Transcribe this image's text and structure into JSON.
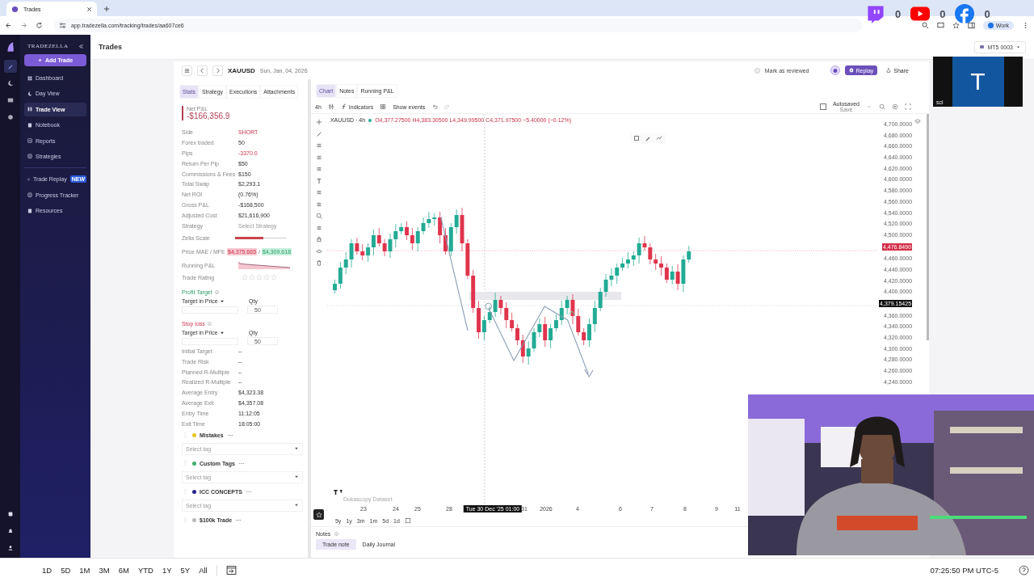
{
  "browser": {
    "tab": {
      "title": "Trades"
    },
    "url": "app.tradezella.com/tracking/trades/aa607ce6",
    "profile": "Work"
  },
  "overlay": {
    "social": [
      {
        "kind": "twitch",
        "count": "0"
      },
      {
        "kind": "youtube",
        "count": "0"
      },
      {
        "kind": "facebook",
        "count": "0"
      }
    ],
    "tile_letter": "T",
    "tile_caption": "sci"
  },
  "sidebar": {
    "brand": "TRADEZELLA",
    "add_button": "Add Trade",
    "items": [
      {
        "label": "Dashboard",
        "selected": false
      },
      {
        "label": "Day View",
        "selected": false
      },
      {
        "label": "Trade View",
        "selected": true
      },
      {
        "label": "Notebook",
        "selected": false
      },
      {
        "label": "Reports",
        "selected": false
      },
      {
        "label": "Strategies",
        "selected": false
      },
      {
        "label": "Trade Replay",
        "selected": false,
        "badge": "NEW"
      },
      {
        "label": "Progress Tracker",
        "selected": false
      },
      {
        "label": "Resources",
        "selected": false
      }
    ]
  },
  "header": {
    "title": "Trades",
    "account": "MT5 0003"
  },
  "trade": {
    "symbol": "XAUUSD",
    "date": "Sun, Jan, 04, 2026",
    "review": {
      "label": "Mark as reviewed",
      "checked": false
    },
    "replay": "Replay",
    "share": "Share"
  },
  "stats_tabs": [
    {
      "label": "Stats",
      "selected": true
    },
    {
      "label": "Strategy",
      "selected": false
    },
    {
      "label": "Executions",
      "selected": false
    },
    {
      "label": "Attachments",
      "selected": false
    }
  ],
  "chart_tabs": [
    {
      "label": "Chart",
      "selected": true
    },
    {
      "label": "Notes",
      "selected": false
    },
    {
      "label": "Running P&L",
      "selected": false
    }
  ],
  "stats": {
    "net_label": "Net P&L",
    "net_value": "-$166,356.9",
    "rows": [
      {
        "label": "Side",
        "value": "SHORT",
        "kind": "negative"
      },
      {
        "label": "Forex traded",
        "value": "50",
        "kind": "normal"
      },
      {
        "label": "Pips",
        "value": "-3370.0",
        "kind": "negative"
      },
      {
        "label": "Return Per Pip",
        "value": "$50",
        "kind": "normal"
      },
      {
        "label": "Commissions & Fees",
        "value": "$150",
        "kind": "normal"
      },
      {
        "label": "Total Swap",
        "value": "$2,293.1",
        "kind": "normal"
      },
      {
        "label": "Net ROI",
        "value": "(0.76%)",
        "kind": "normal"
      },
      {
        "label": "Gross P&L",
        "value": "-$168,500",
        "kind": "normal"
      },
      {
        "label": "Adjusted Cost",
        "value": "$21,616,900",
        "kind": "normal"
      },
      {
        "label": "Strategy",
        "value": "Select Strategy",
        "kind": "muted"
      }
    ],
    "zella": {
      "label": "Zella Scale",
      "level": 0.55
    },
    "mae_mfe": {
      "label": "Price MAE / MFE",
      "mae": "$4,375.665",
      "separator": "/",
      "mfe": "$4,309.618"
    },
    "running": {
      "label": "Running P&L"
    },
    "rating": {
      "label": "Trade Rating",
      "stars": 0
    },
    "targets": [
      {
        "title": "Profit Target",
        "kind": "positive",
        "mode": "Target in Price",
        "qty_label": "Qty",
        "qty": "50"
      },
      {
        "title": "Stop loss",
        "kind": "negative",
        "mode": "Target in Price",
        "qty_label": "Qty",
        "qty": "50"
      }
    ],
    "rows2": [
      {
        "label": "Initial Target",
        "value": "--"
      },
      {
        "label": "Trade Risk",
        "value": "--"
      },
      {
        "label": "Planned R-Multiple",
        "value": "--"
      },
      {
        "label": "Realized R-Multiple",
        "value": "--"
      },
      {
        "label": "Average Entry",
        "value": "$4,323.38"
      },
      {
        "label": "Average Exit",
        "value": "$4,357.08"
      },
      {
        "label": "Entry Time",
        "value": "11:12:05"
      },
      {
        "label": "Exit Time",
        "value": "18:05:00"
      }
    ],
    "tag_groups": [
      {
        "name": "Mistakes",
        "color": "#e8c21e",
        "placeholder": "Select tag"
      },
      {
        "name": "Custom Tags",
        "color": "#3cae6a",
        "placeholder": "Select tag"
      },
      {
        "name": "ICC CONCEPTS",
        "color": "#25258f",
        "placeholder": "Select tag"
      },
      {
        "name": "$100k Trade",
        "color": "#b8b8b8"
      }
    ]
  },
  "chart": {
    "toolbar": {
      "interval": "4h",
      "indicators": "Indicators",
      "events": "Show events",
      "autosaved": "Autosaved",
      "save": "Save",
      "checked": false
    },
    "legend": {
      "symbol": "XAUUSD · 4h",
      "ohlc": "O4,377.27500 H4,383.30500 L4,349.99500 C4,371.97500 −5.40000 (−0.12%)"
    },
    "price_labels": [
      {
        "text": "4,700.0000",
        "kind": "tick"
      },
      {
        "text": "4,680.0000",
        "kind": "tick"
      },
      {
        "text": "4,660.0000",
        "kind": "tick"
      },
      {
        "text": "4,640.0000",
        "kind": "tick"
      },
      {
        "text": "4,620.0000",
        "kind": "tick"
      },
      {
        "text": "4,600.0000",
        "kind": "tick"
      },
      {
        "text": "4,580.0000",
        "kind": "tick"
      },
      {
        "text": "4,560.0000",
        "kind": "tick"
      },
      {
        "text": "4,540.0000",
        "kind": "tick"
      },
      {
        "text": "4,520.0000",
        "kind": "tick"
      },
      {
        "text": "4,500.0000",
        "kind": "tick"
      },
      {
        "text": "4,476.8490",
        "kind": "current"
      },
      {
        "text": "4,460.0000",
        "kind": "tick"
      },
      {
        "text": "4,440.0000",
        "kind": "tick"
      },
      {
        "text": "4,420.0000",
        "kind": "tick"
      },
      {
        "text": "4,400.0000",
        "kind": "tick"
      },
      {
        "text": "4,379.15425",
        "kind": "cursor"
      },
      {
        "text": "4,360.0000",
        "kind": "tick"
      },
      {
        "text": "4,340.0000",
        "kind": "tick"
      },
      {
        "text": "4,320.0000",
        "kind": "tick"
      },
      {
        "text": "4,300.0000",
        "kind": "tick"
      },
      {
        "text": "4,280.0000",
        "kind": "tick"
      },
      {
        "text": "4,260.0000",
        "kind": "tick"
      },
      {
        "text": "4,240.0000",
        "kind": "tick"
      }
    ],
    "time_labels": [
      {
        "text": "23",
        "kind": "tick"
      },
      {
        "text": "24",
        "kind": "tick"
      },
      {
        "text": "25",
        "kind": "tick"
      },
      {
        "text": "28",
        "kind": "tick"
      },
      {
        "text": "Tue 30 Dec '25  01:00",
        "kind": "cursor"
      },
      {
        "text": "31",
        "kind": "tick"
      },
      {
        "text": "2026",
        "kind": "tick"
      },
      {
        "text": "4",
        "kind": "tick"
      },
      {
        "text": "6",
        "kind": "tick"
      },
      {
        "text": "7",
        "kind": "tick"
      },
      {
        "text": "8",
        "kind": "tick"
      },
      {
        "text": "9",
        "kind": "tick"
      },
      {
        "text": "11",
        "kind": "tick"
      }
    ],
    "source": "Dukascopy Dataset",
    "ranges": [
      "5y",
      "1y",
      "3m",
      "1m",
      "5d",
      "1d"
    ]
  },
  "notes": {
    "title": "Notes",
    "tabs": [
      {
        "label": "Trade note",
        "selected": true
      },
      {
        "label": "Daily Journal",
        "selected": false
      }
    ]
  },
  "bottom_bar": {
    "ranges": [
      "1D",
      "5D",
      "1M",
      "3M",
      "6M",
      "YTD",
      "1Y",
      "5Y",
      "All"
    ],
    "clock": "07:25:50 PM UTC-5"
  }
}
